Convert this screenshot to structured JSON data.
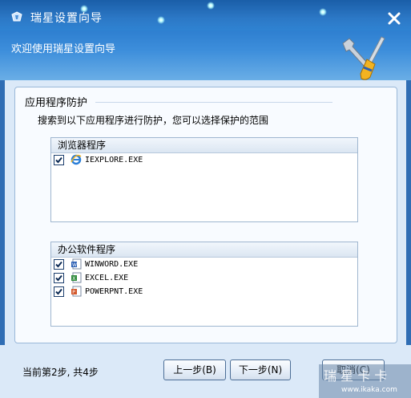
{
  "window": {
    "title": "瑞星设置向导"
  },
  "header": {
    "subtitle": "欢迎使用瑞星设置向导"
  },
  "section": {
    "title": "应用程序防护",
    "description": "搜索到以下应用程序进行防护，您可以选择保护的范围"
  },
  "groups": {
    "browser": {
      "title": "浏览器程序",
      "items": [
        {
          "label": "IEXPLORE.EXE",
          "checked": true,
          "icon": "ie-icon"
        }
      ]
    },
    "office": {
      "title": "办公软件程序",
      "items": [
        {
          "label": "WINWORD.EXE",
          "checked": true,
          "icon": "word-icon"
        },
        {
          "label": "EXCEL.EXE",
          "checked": true,
          "icon": "excel-icon"
        },
        {
          "label": "POWERPNT.EXE",
          "checked": true,
          "icon": "powerpoint-icon"
        }
      ]
    }
  },
  "footer": {
    "step_text": "当前第2步, 共4步",
    "prev_label": "上一步(B)",
    "next_label": "下一步(N)",
    "cancel_label": "取消(C)"
  },
  "watermark": {
    "text": "www.ikaka.com"
  },
  "colors": {
    "titlebar": "#2c78c6",
    "content": "#dbe9f8"
  }
}
